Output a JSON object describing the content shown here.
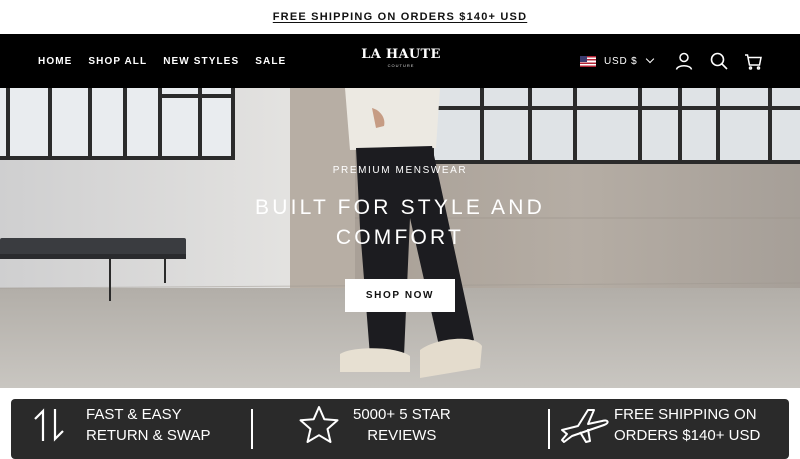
{
  "announcement": {
    "text": "FREE SHIPPING ON ORDERS $140+ USD"
  },
  "header": {
    "nav": [
      "HOME",
      "SHOP ALL",
      "NEW STYLES",
      "SALE"
    ],
    "logo": {
      "name": "LA HAUTE",
      "tagline": "COUTURE"
    },
    "currency": "USD $",
    "icons": [
      "account-icon",
      "search-icon",
      "cart-icon"
    ]
  },
  "hero": {
    "eyebrow": "PREMIUM MENSWEAR",
    "headline": "BUILT FOR STYLE AND COMFORT",
    "cta": "SHOP NOW"
  },
  "features": [
    {
      "icon": "swap-arrows-icon",
      "line1": "FAST & EASY",
      "line2": "RETURN & SWAP"
    },
    {
      "icon": "star-icon",
      "line1": "5000+ 5 STAR",
      "line2": "REVIEWS"
    },
    {
      "icon": "airplane-icon",
      "line1": "FREE SHIPPING ON",
      "line2": "ORDERS $140+ USD"
    }
  ],
  "colors": {
    "header_bg": "#000000",
    "feature_bar_bg": "#2a2a2a",
    "accent": "#ffffff"
  }
}
